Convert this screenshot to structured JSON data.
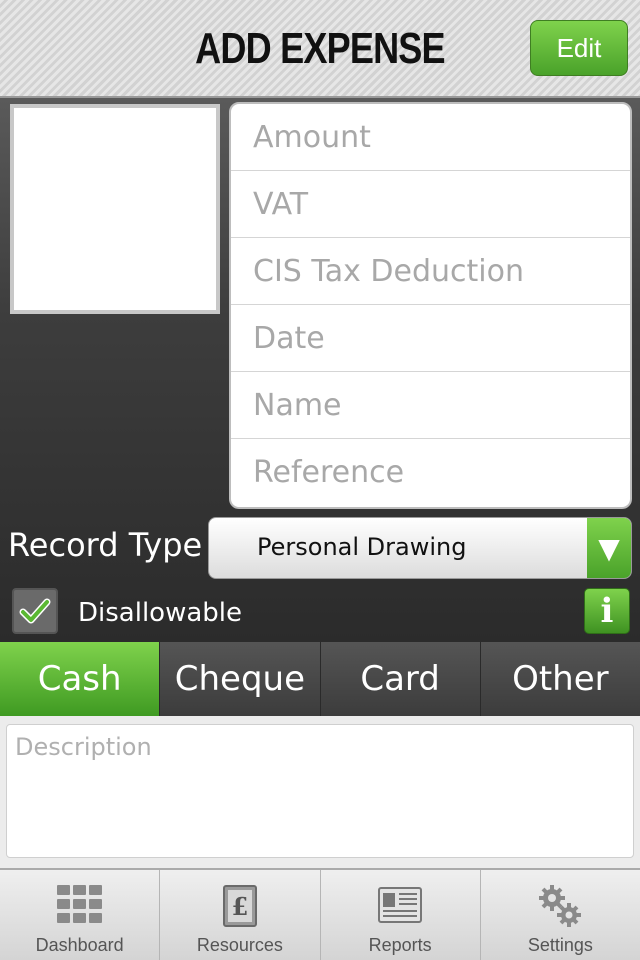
{
  "header": {
    "title": "ADD EXPENSE",
    "edit_label": "Edit"
  },
  "fields": [
    {
      "placeholder": "Amount"
    },
    {
      "placeholder": "VAT"
    },
    {
      "placeholder": "CIS Tax Deduction"
    },
    {
      "placeholder": "Date"
    },
    {
      "placeholder": "Name"
    },
    {
      "placeholder": "Reference"
    }
  ],
  "record_type": {
    "label": "Record Type",
    "value": "Personal Drawing",
    "arrow_icon": "▼"
  },
  "disallowable": {
    "label": "Disallowable",
    "checked": true,
    "info_icon": "i"
  },
  "payment_tabs": [
    {
      "label": "Cash",
      "active": true
    },
    {
      "label": "Cheque",
      "active": false
    },
    {
      "label": "Card",
      "active": false
    },
    {
      "label": "Other",
      "active": false
    }
  ],
  "description": {
    "placeholder": "Description"
  },
  "tabbar": [
    {
      "label": "Dashboard",
      "icon": "grid-icon"
    },
    {
      "label": "Resources",
      "icon": "pound-book-icon"
    },
    {
      "label": "Reports",
      "icon": "newspaper-icon"
    },
    {
      "label": "Settings",
      "icon": "gears-icon"
    }
  ],
  "colors": {
    "accent_green": "#5bb832",
    "header_text": "#111111",
    "dark_bg": "#2b2b2b"
  }
}
